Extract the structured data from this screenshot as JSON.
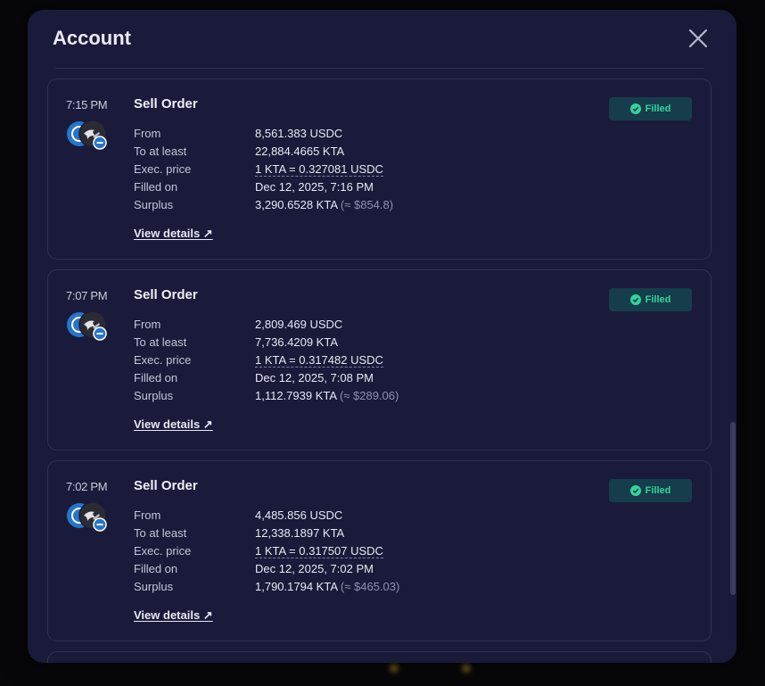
{
  "modal": {
    "title": "Account",
    "close_icon": "close-icon"
  },
  "labels": {
    "from": "From",
    "to_at_least": "To at least",
    "exec_price": "Exec. price",
    "filled_on": "Filled on",
    "surplus": "Surplus",
    "view_details": "View details ↗"
  },
  "orders": [
    {
      "time": "7:15 PM",
      "type": "Sell Order",
      "status": "Filled",
      "from": "8,561.383 USDC",
      "to_at_least": "22,884.4665 KTA",
      "exec_price": "1 KTA = 0.327081 USDC",
      "filled_on": "Dec 12, 2025, 7:16 PM",
      "surplus": "3,290.6528 KTA",
      "surplus_usd": "(≈ $854.8)"
    },
    {
      "time": "7:07 PM",
      "type": "Sell Order",
      "status": "Filled",
      "from": "2,809.469 USDC",
      "to_at_least": "7,736.4209 KTA",
      "exec_price": "1 KTA = 0.317482 USDC",
      "filled_on": "Dec 12, 2025, 7:08 PM",
      "surplus": "1,112.7939 KTA",
      "surplus_usd": "(≈ $289.06)"
    },
    {
      "time": "7:02 PM",
      "type": "Sell Order",
      "status": "Filled",
      "from": "4,485.856 USDC",
      "to_at_least": "12,338.1897 KTA",
      "exec_price": "1 KTA = 0.317507 USDC",
      "filled_on": "Dec 12, 2025, 7:02 PM",
      "surplus": "1,790.1794 KTA",
      "surplus_usd": "(≈ $465.03)"
    }
  ],
  "colors": {
    "modal_bg": "#1a1b3a",
    "badge_bg": "#163d4c",
    "badge_text": "#33d49a",
    "usdc_blue": "#2775ca"
  }
}
